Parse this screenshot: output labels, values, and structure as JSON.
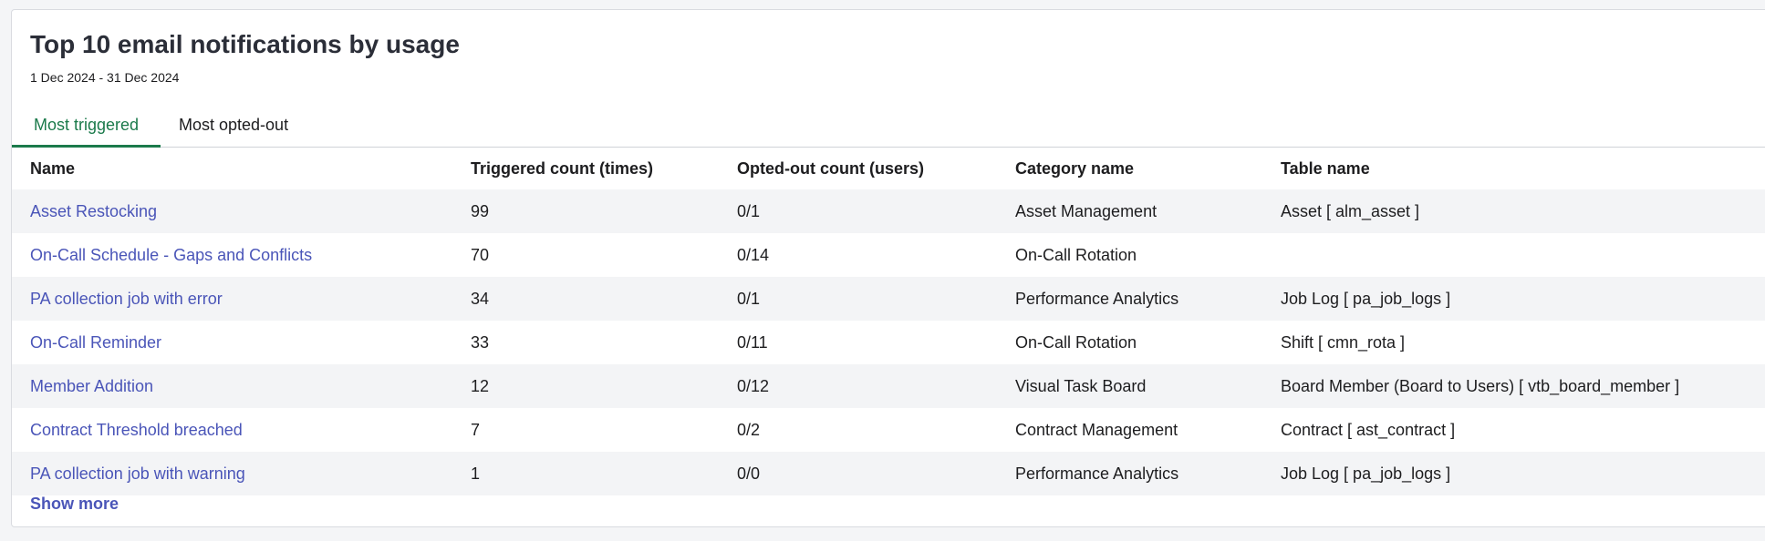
{
  "widget": {
    "title": "Top 10 email notifications by usage",
    "date_range": "1 Dec 2024 - 31 Dec 2024",
    "show_more_label": "Show more"
  },
  "tabs": [
    {
      "label": "Most triggered",
      "active": true
    },
    {
      "label": "Most opted-out",
      "active": false
    }
  ],
  "table": {
    "columns": [
      "Name",
      "Triggered count (times)",
      "Opted-out count (users)",
      "Category name",
      "Table name"
    ],
    "rows": [
      {
        "name": "Asset Restocking",
        "triggered": "99",
        "opted_out": "0/1",
        "category": "Asset Management",
        "table": "Asset [ alm_asset ]"
      },
      {
        "name": "On-Call Schedule - Gaps and Conflicts",
        "triggered": "70",
        "opted_out": "0/14",
        "category": "On-Call Rotation",
        "table": ""
      },
      {
        "name": "PA collection job with error",
        "triggered": "34",
        "opted_out": "0/1",
        "category": "Performance Analytics",
        "table": "Job Log [ pa_job_logs ]"
      },
      {
        "name": "On-Call Reminder",
        "triggered": "33",
        "opted_out": "0/11",
        "category": "On-Call Rotation",
        "table": "Shift [ cmn_rota ]"
      },
      {
        "name": "Member Addition",
        "triggered": "12",
        "opted_out": "0/12",
        "category": "Visual Task Board",
        "table": "Board Member (Board to Users) [ vtb_board_member ]"
      },
      {
        "name": "Contract Threshold breached",
        "triggered": "7",
        "opted_out": "0/2",
        "category": "Contract Management",
        "table": "Contract [ ast_contract ]"
      },
      {
        "name": "PA collection job with warning",
        "triggered": "1",
        "opted_out": "0/0",
        "category": "Performance Analytics",
        "table": "Job Log [ pa_job_logs ]"
      }
    ]
  },
  "colors": {
    "link": "#4a55b8",
    "active_tab": "#1b7a4b",
    "stripe": "#f3f4f6"
  }
}
